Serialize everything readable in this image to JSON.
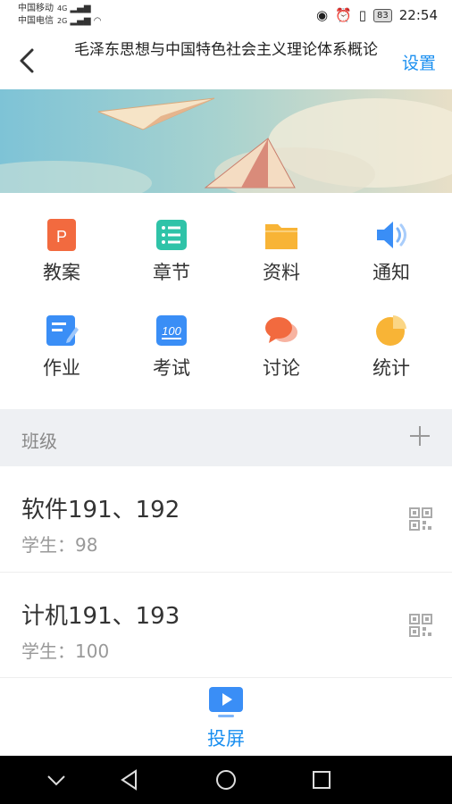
{
  "status": {
    "carrier1": "中国移动",
    "carrier2": "中国电信",
    "sig1": "4G",
    "sig2": "2G",
    "battery": "83",
    "time": "22:54"
  },
  "header": {
    "title": "毛泽东思想与中国特色社会主义理论体系概论",
    "settings": "设置"
  },
  "grid": [
    {
      "label": "教案",
      "icon": "ppt-icon",
      "color": "#f26a3f"
    },
    {
      "label": "章节",
      "icon": "list-icon",
      "color": "#2fc3a8"
    },
    {
      "label": "资料",
      "icon": "folder-icon",
      "color": "#f8b436"
    },
    {
      "label": "通知",
      "icon": "speaker-icon",
      "color": "#3a8ef6"
    },
    {
      "label": "作业",
      "icon": "edit-icon",
      "color": "#3a8ef6"
    },
    {
      "label": "考试",
      "icon": "exam-100-icon",
      "color": "#3a8ef6"
    },
    {
      "label": "讨论",
      "icon": "chat-bubble-icon",
      "color": "#f26a3f"
    },
    {
      "label": "统计",
      "icon": "pie-chart-icon",
      "color": "#f8b436"
    }
  ],
  "section": {
    "label": "班级"
  },
  "classes": [
    {
      "name": "软件191、192",
      "students": "学生：98"
    },
    {
      "name": "计机191、193",
      "students": "学生：100"
    }
  ],
  "bottom": {
    "label": "投屏"
  },
  "colors": {
    "accent": "#1a8ff0",
    "section_bg": "#eef0f3"
  }
}
